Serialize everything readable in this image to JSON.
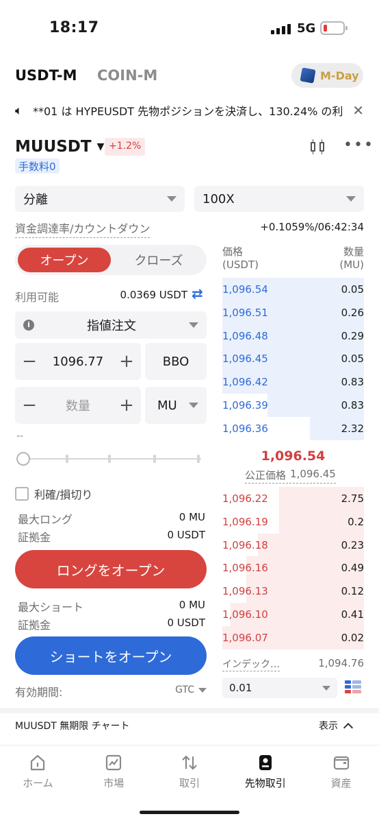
{
  "status": {
    "time": "18:17",
    "network": "5G"
  },
  "market_tabs": {
    "usdt_m": "USDT-M",
    "coin_m": "COIN-M",
    "promo": "M-Day"
  },
  "announcement": "**01 は HYPEUSDT 先物ポジションを決済し、130.24% の利",
  "symbol": {
    "name": "MUUSDT",
    "change": "+1.2%",
    "fee_badge": "手数料0"
  },
  "controls": {
    "margin_mode": "分離",
    "leverage": "100X",
    "funding_label": "資金調達率/カウントダウン",
    "funding_value": "+0.1059%/06:42:34",
    "open_label": "オープン",
    "close_label": "クローズ",
    "available_label": "利用可能",
    "available_value": "0.0369 USDT",
    "order_type": "指値注文",
    "price_value": "1096.77",
    "bbo_label": "BBO",
    "qty_placeholder": "数量",
    "qty_unit": "MU",
    "dash": "--",
    "slider_level": 0,
    "tpsl_label": "利確/損切り",
    "max_long_label": "最大ロング",
    "max_long_value": "0 MU",
    "margin_label_1": "証拠金",
    "margin_value_1": "0 USDT",
    "open_long": "ロングをオープン",
    "max_short_label": "最大ショート",
    "max_short_value": "0 MU",
    "margin_label_2": "証拠金",
    "margin_value_2": "0 USDT",
    "open_short": "ショートをオープン",
    "validity_label": "有効期間:",
    "validity_value": "GTC"
  },
  "orderbook": {
    "price_header": "価格",
    "price_unit": "(USDT)",
    "qty_header": "数量",
    "qty_unit": "(MU)",
    "asks": [
      {
        "price": "1,096.54",
        "qty": "0.05",
        "depth": 1.0
      },
      {
        "price": "1,096.51",
        "qty": "0.26",
        "depth": 1.0
      },
      {
        "price": "1,096.48",
        "qty": "0.29",
        "depth": 1.0
      },
      {
        "price": "1,096.45",
        "qty": "0.05",
        "depth": 1.0
      },
      {
        "price": "1,096.42",
        "qty": "0.83",
        "depth": 1.0
      },
      {
        "price": "1,096.39",
        "qty": "0.83",
        "depth": 0.68
      },
      {
        "price": "1,096.36",
        "qty": "2.32",
        "depth": 0.38
      }
    ],
    "last_price": "1,096.54",
    "fair_label": "公正価格",
    "fair_value": "1,096.45",
    "bids": [
      {
        "price": "1,096.22",
        "qty": "2.75",
        "depth": 0.6
      },
      {
        "price": "1,096.19",
        "qty": "0.2",
        "depth": 0.6
      },
      {
        "price": "1,096.18",
        "qty": "0.23",
        "depth": 0.75
      },
      {
        "price": "1,096.16",
        "qty": "0.49",
        "depth": 0.83
      },
      {
        "price": "1,096.13",
        "qty": "0.12",
        "depth": 0.83
      },
      {
        "price": "1,096.10",
        "qty": "0.41",
        "depth": 0.94
      },
      {
        "price": "1,096.07",
        "qty": "0.02",
        "depth": 1.0
      }
    ],
    "index_label": "インデック…",
    "index_value": "1,094.76",
    "precision": "0.01"
  },
  "chart_strip": {
    "label": "MUUSDT 無期限 チャート",
    "toggle": "表示"
  },
  "nav": [
    {
      "label": "ホーム",
      "icon": "home-icon"
    },
    {
      "label": "市場",
      "icon": "chart-icon"
    },
    {
      "label": "取引",
      "icon": "swap-icon"
    },
    {
      "label": "先物取引",
      "icon": "futures-icon"
    },
    {
      "label": "資産",
      "icon": "wallet-icon"
    }
  ],
  "colors": {
    "red": "#d8453f",
    "blue": "#2e6bd8",
    "gold": "#c9a045"
  }
}
